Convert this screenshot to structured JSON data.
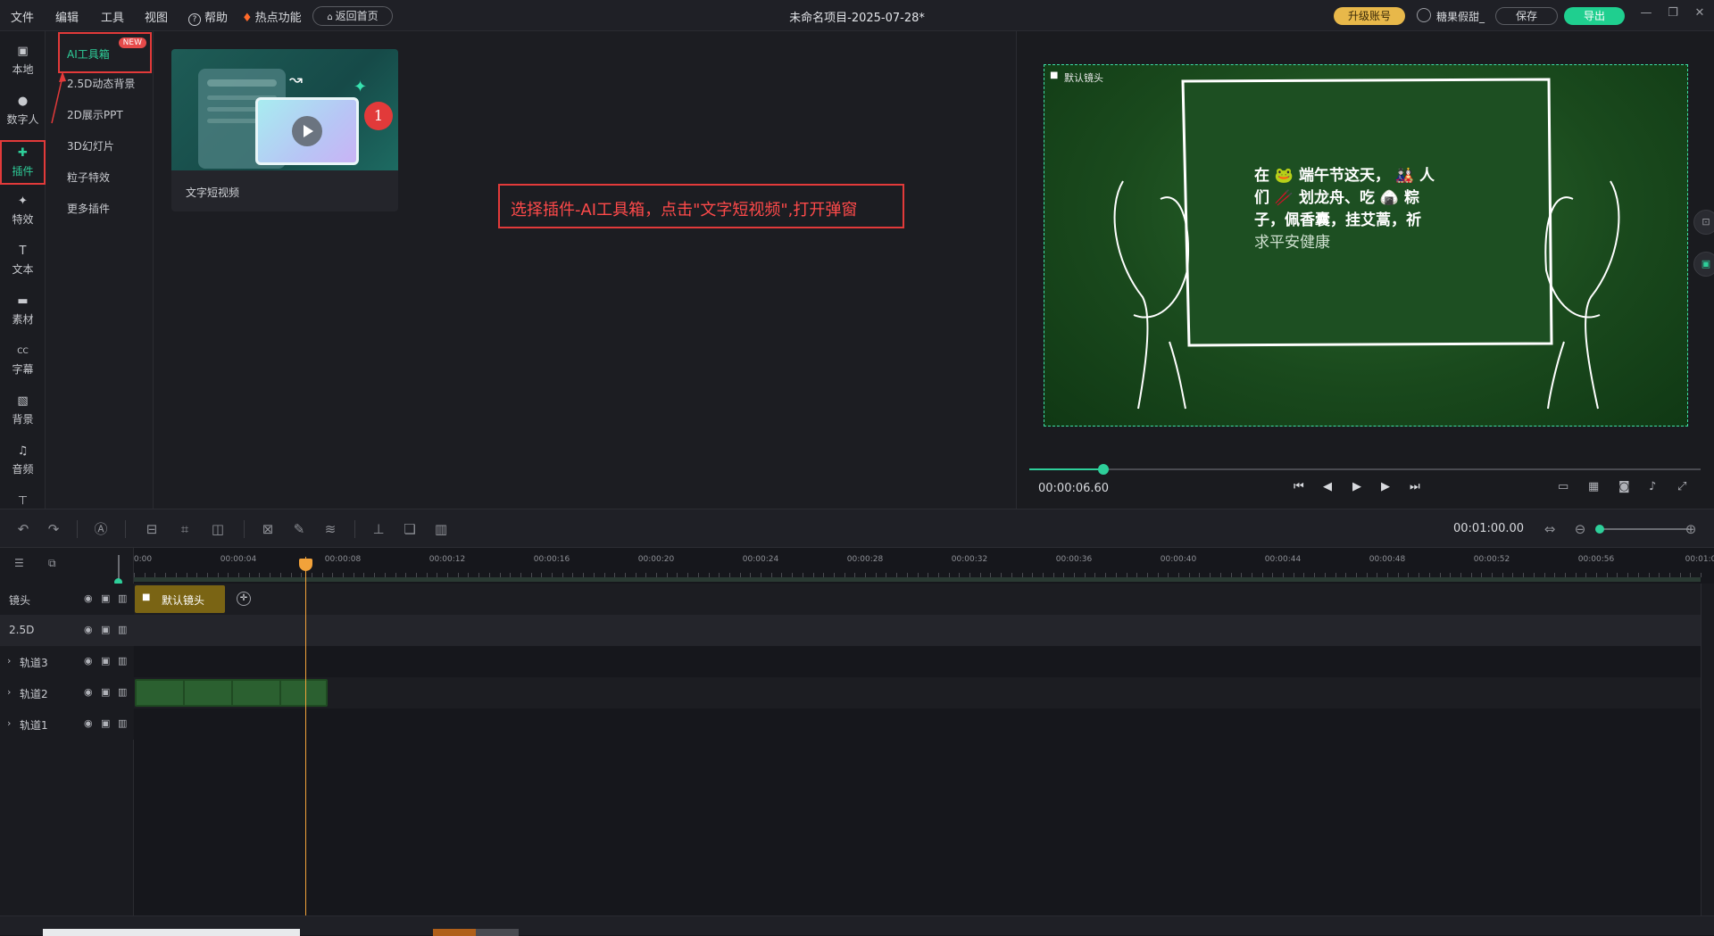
{
  "menu": {
    "file": "文件",
    "edit": "编辑",
    "tools": "工具",
    "view": "视图",
    "help": "帮助",
    "hot": "热点功能",
    "home": "返回首页"
  },
  "window": {
    "title": "未命名项目-2025-07-28*",
    "upgrade": "升级账号",
    "user": "糖果假甜_",
    "save": "保存",
    "export": "导出"
  },
  "sidebar": {
    "items": [
      {
        "label": "本地",
        "icon": "local-icon"
      },
      {
        "label": "数字人",
        "icon": "person-icon"
      },
      {
        "label": "插件",
        "icon": "puzzle-icon"
      },
      {
        "label": "特效",
        "icon": "effects-icon"
      },
      {
        "label": "文本",
        "icon": "text-icon"
      },
      {
        "label": "素材",
        "icon": "folder-icon"
      },
      {
        "label": "字幕",
        "icon": "caption-icon"
      },
      {
        "label": "背景",
        "icon": "background-icon"
      },
      {
        "label": "音频",
        "icon": "music-icon"
      }
    ]
  },
  "subpanel": {
    "items": [
      "AI工具箱",
      "2.5D动态背景",
      "2D展示PPT",
      "3D幻灯片",
      "粒子特效",
      "更多插件"
    ],
    "new_badge": "NEW"
  },
  "content": {
    "card_label": "文字短视频",
    "step_number": "1",
    "callout": "选择插件-AI工具箱，点击\"文字短视频\",打开弹窗"
  },
  "preview": {
    "camera_label": "默认镜头",
    "caption_lines": [
      "在 🐸 端午节这天， 🎎 人",
      "们 🥢 划龙舟、吃 🍙 粽",
      "子，佩香囊，挂艾蒿，祈",
      "求平安健康"
    ],
    "time": "00:00:06.60",
    "progress": 0.11
  },
  "toolbar": {
    "duration": "00:01:00.00"
  },
  "timeline": {
    "ruler": [
      "0:00",
      "00:00:04",
      "00:00:08",
      "00:00:12",
      "00:00:16",
      "00:00:20",
      "00:00:24",
      "00:00:28",
      "00:00:32",
      "00:00:36",
      "00:00:40",
      "00:00:44",
      "00:00:48",
      "00:00:52",
      "00:00:56",
      "00:01:0"
    ],
    "tracks": [
      "镜头",
      "2.5D",
      "轨道3",
      "轨道2",
      "轨道1"
    ],
    "clip_label": "默认镜头"
  },
  "colors": {
    "accent": "#2ecf9a",
    "upgrade": "#e8b84a",
    "annotation": "#e23a3a",
    "clip": "#7a6414"
  }
}
